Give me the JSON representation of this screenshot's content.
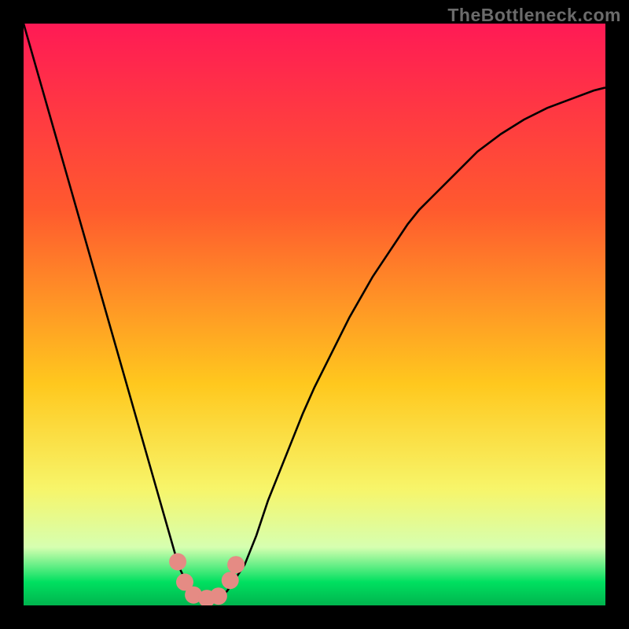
{
  "attribution": "TheBottleneck.com",
  "chart_data": {
    "type": "line",
    "title": "",
    "xlabel": "",
    "ylabel": "",
    "xlim": [
      0,
      100
    ],
    "ylim": [
      0,
      100
    ],
    "grid": false,
    "legend": false,
    "x": [
      0,
      2,
      4,
      6,
      8,
      10,
      12,
      14,
      16,
      18,
      20,
      22,
      24,
      26,
      27,
      28,
      29,
      30,
      31,
      32,
      33,
      34,
      35,
      36,
      38,
      40,
      42,
      44,
      46,
      48,
      50,
      52,
      54,
      56,
      58,
      60,
      62,
      64,
      66,
      68,
      70,
      74,
      78,
      82,
      86,
      90,
      94,
      98,
      100
    ],
    "series": [
      {
        "name": "bottleneck-curve",
        "values": [
          100,
          93,
          86,
          79,
          72,
          65,
          58,
          51,
          44,
          37,
          30,
          23,
          16,
          9,
          6,
          4,
          2.5,
          1.5,
          1,
          1,
          1,
          1.5,
          2.5,
          4,
          7,
          12,
          18,
          23,
          28,
          33,
          37.5,
          41.5,
          45.5,
          49.5,
          53,
          56.5,
          59.5,
          62.5,
          65.5,
          68,
          70,
          74,
          78,
          81,
          83.5,
          85.5,
          87,
          88.5,
          89
        ]
      }
    ],
    "markers": {
      "name": "highlight-dots",
      "points": [
        {
          "x": 26.5,
          "y": 7.5
        },
        {
          "x": 27.7,
          "y": 4
        },
        {
          "x": 29.2,
          "y": 1.8
        },
        {
          "x": 31.5,
          "y": 1.2
        },
        {
          "x": 33.5,
          "y": 1.6
        },
        {
          "x": 35.5,
          "y": 4.3
        },
        {
          "x": 36.5,
          "y": 7
        }
      ]
    }
  },
  "gradient_colors": {
    "top": "#ff1a55",
    "upper": "#ff5a2e",
    "mid": "#ffc81e",
    "lower": "#f7f56a",
    "band": "#d6ffb0",
    "bottom_stripe": "#00e060",
    "bottom_edge": "#00b44e"
  },
  "marker_color": "#e58b84",
  "curve_color": "#000000"
}
